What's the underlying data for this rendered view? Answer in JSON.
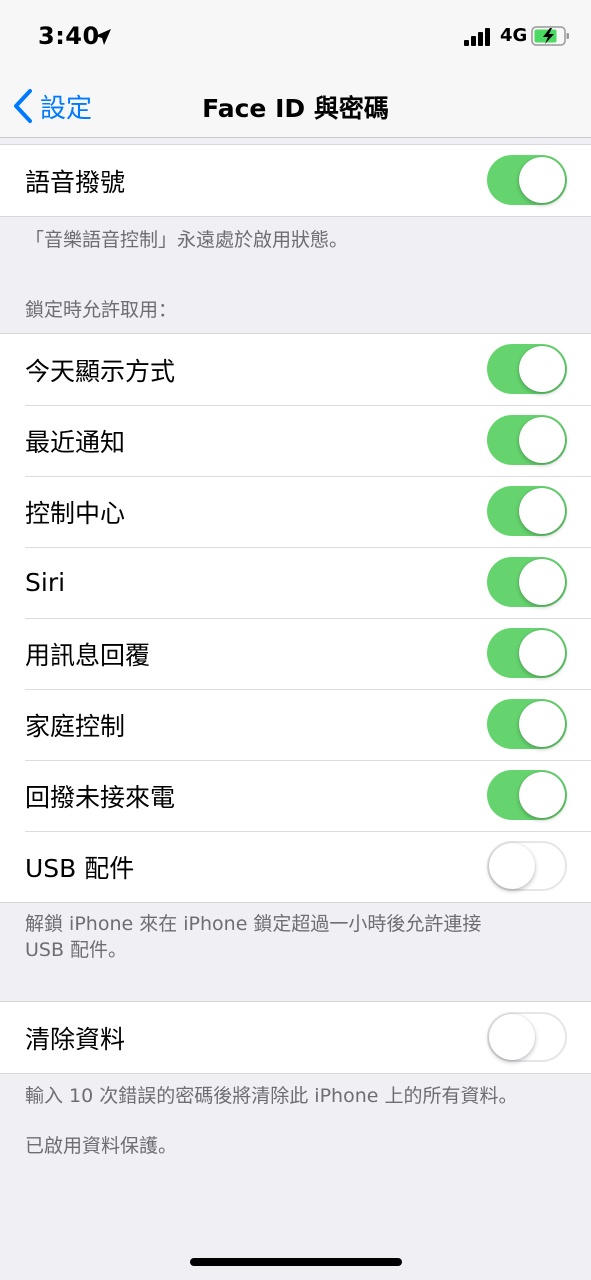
{
  "status_bar": {
    "time": "3:40",
    "network": "4G",
    "icons": [
      "location-arrow-icon",
      "signal-icon",
      "battery-charging-icon"
    ]
  },
  "nav": {
    "back_label": "設定",
    "title": "Face ID 與密碼"
  },
  "group_voice": {
    "items": [
      {
        "label": "語音撥號",
        "on": true
      }
    ]
  },
  "footer_voice": "「音樂語音控制」永遠處於啟用狀態。",
  "lock_header": "鎖定時允許取用：",
  "group_lock": {
    "items": [
      {
        "label": "今天顯示方式",
        "on": true
      },
      {
        "label": "最近通知",
        "on": true
      },
      {
        "label": "控制中心",
        "on": true
      },
      {
        "label": "Siri",
        "on": true
      },
      {
        "label": "用訊息回覆",
        "on": true
      },
      {
        "label": "家庭控制",
        "on": true
      },
      {
        "label": "回撥未接來電",
        "on": true
      },
      {
        "label": "USB 配件",
        "on": false
      }
    ]
  },
  "footer_usb": {
    "line1": "解鎖 iPhone 來在 iPhone 鎖定超過一小時後允許連接",
    "line2": "USB 配件。"
  },
  "group_erase": {
    "items": [
      {
        "label": "清除資料",
        "on": false
      }
    ]
  },
  "footer_erase": "輸入 10 次錯誤的密碼後將清除此 iPhone 上的所有資料。",
  "footer_protection": "已啟用資料保護。",
  "colors": {
    "accent": "#007aff",
    "toggle_on": "#65d46e",
    "background": "#efeff4"
  }
}
